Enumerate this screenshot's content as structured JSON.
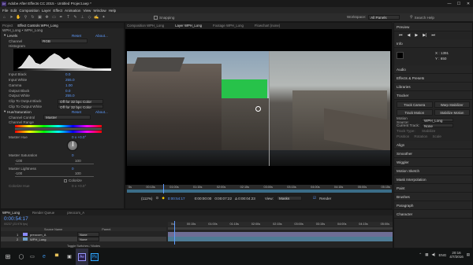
{
  "window": {
    "title": "Adobe After Effects CC 2015 - Untitled Project.aep *",
    "min": "—",
    "max": "☐",
    "close": "✕"
  },
  "menu": [
    "File",
    "Edit",
    "Composition",
    "Layer",
    "Effect",
    "Animation",
    "View",
    "Window",
    "Help"
  ],
  "toolbar": {
    "snapping": "Snapping",
    "workspace_label": "Workspace:",
    "workspace_value": "All Panels",
    "search_placeholder": "Search Help"
  },
  "left_panel": {
    "tabs": [
      "Project",
      "Effect Controls WPH_Long"
    ],
    "breadcrumb": "WPH_Long • WPH_Long",
    "effects": [
      {
        "name": "Levels",
        "reset": "Reset",
        "about": "About...",
        "channel_label": "Channel",
        "channel_value": "RGB",
        "histogram_label": "Histogram",
        "props": [
          [
            "Input Black",
            "0.0"
          ],
          [
            "Input White",
            "255.0"
          ],
          [
            "Gamma",
            "1.00"
          ],
          [
            "Output Black",
            "0.0"
          ],
          [
            "Output White",
            "255.0"
          ]
        ],
        "clip_black_label": "Clip To Output Black",
        "clip_black_value": "Off for 32 bpc Color",
        "clip_white_label": "Clip To Output White",
        "clip_white_value": "Off for 32 bpc Color"
      },
      {
        "name": "Hue/Saturation",
        "reset": "Reset",
        "about": "About...",
        "control_label": "Channel Control",
        "control_value": "Master",
        "range_label": "Channel Range",
        "hue_label": "Master Hue",
        "hue_value": "0 x +0.0°",
        "sat_label": "Master Saturation",
        "sat_value": "0",
        "sat_min": "-100",
        "sat_max": "100",
        "light_label": "Master Lightness",
        "light_value": "0",
        "light_min": "-100",
        "light_max": "100",
        "colorize_label": "Colorize",
        "colorize_hue_label": "Colorize Hue",
        "colorize_hue_value": "0 x +0.0°"
      }
    ]
  },
  "comp_panel": {
    "tabs": [
      "Composition WPH_Long",
      "Layer WPH_Long",
      "Footage WPH_Long",
      "Flowchart (none)"
    ],
    "ruler": [
      "0s",
      "00:15s",
      "01:00s",
      "01:15s",
      "02:00s",
      "02:15s",
      "03:00s",
      "03:15s",
      "04:00s",
      "04:15s",
      "05:00s",
      "05:15s"
    ],
    "zoom": "(112%)",
    "timecode": "0:00:54:17",
    "start_time": "0:00:00:00",
    "end_time": "0:00:07:22",
    "duration": "Δ 0:00:04:23",
    "view_label": "View:",
    "view_value": "Masks",
    "render_label": "Render"
  },
  "right_panel": {
    "preview": "Preview",
    "info": "Info",
    "info_x": "X : 1391",
    "info_y": "Y : 650",
    "audio": "Audio",
    "effects_presets": "Effects & Presets",
    "libraries": "Libraries",
    "tracker": "Tracker",
    "track_camera": "Track Camera",
    "warp_stabilizer": "Warp Stabilizer",
    "track_motion": "Track Motion",
    "stabilize_motion": "Stabilize Motion",
    "motion_source_label": "Motion Source:",
    "motion_source_value": "WPH_Long",
    "current_track_label": "Current Track:",
    "current_track_value": "None",
    "track_type_label": "Track Type:",
    "track_type_value": "Stabilize",
    "position": "Position",
    "rotation": "Rotation",
    "scale": "Scale",
    "sections": [
      "Align",
      "Smoother",
      "Wiggler",
      "Motion Sketch",
      "Mask Interpolation",
      "Paint",
      "Brushes",
      "Paragraph",
      "Character"
    ]
  },
  "timeline": {
    "tabs": [
      "WPH_Long",
      "Render Queue",
      "preocom_A"
    ],
    "timecode": "0:00:54:17",
    "timecode_sub": "00237 (23.976 fps)",
    "col_source": "Source Name",
    "col_parent": "Parent",
    "layers": [
      {
        "num": "1",
        "name": "preocom_A",
        "parent": "None"
      },
      {
        "num": "2",
        "name": "WPH_Long",
        "parent": "None"
      }
    ],
    "ruler": [
      "0s",
      "00:15s",
      "01:00s",
      "01:15s",
      "02:00s",
      "02:15s",
      "03:00s",
      "03:15s",
      "04:00s",
      "04:15s",
      "05:00s"
    ],
    "toggle": "Toggle Switches / Modes"
  },
  "taskbar": {
    "search_placeholder": "Ask me anything",
    "time": "20:16",
    "date": "4/7/2016",
    "lang": "ENG"
  },
  "colors": {
    "accent": "#5e9bff",
    "ae_purple": "#9999ff",
    "green_screen": "#27c24a"
  }
}
